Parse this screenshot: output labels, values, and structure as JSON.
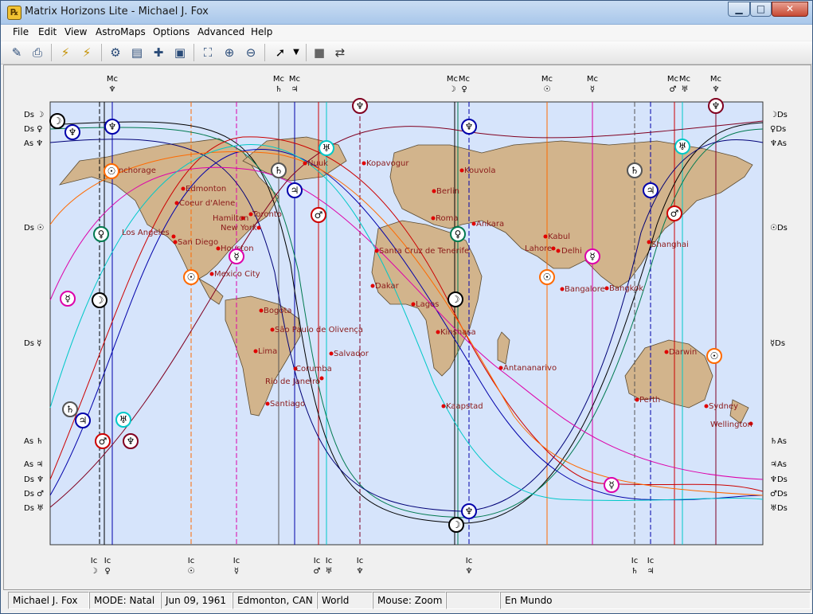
{
  "window": {
    "title": "Matrix Horizons Lite - Michael J. Fox",
    "app_icon": "app-logo-icon"
  },
  "menu": [
    "File",
    "Edit",
    "View",
    "AstroMaps",
    "Options",
    "Advanced",
    "Help"
  ],
  "toolbar_icons": [
    "edit-chart-icon",
    "print-icon",
    "planet-lines-icon",
    "planet-lines-alt-icon",
    "settings-icon",
    "chart-data-icon",
    "add-location-icon",
    "monitor-icon",
    "fit-map-icon",
    "zoom-in-icon",
    "zoom-out-icon",
    "pointer-icon",
    "pointer-dropdown-icon",
    "stop-icon",
    "swap-icon"
  ],
  "map": {
    "top_labels": [
      {
        "label": "Mc",
        "glyph": "♆"
      },
      {
        "label": "Mc",
        "glyph": "♄"
      },
      {
        "label": "Mc",
        "glyph": "♃"
      },
      {
        "label": "Mc",
        "glyph": "☽"
      },
      {
        "label": "Mc",
        "glyph": "♀"
      },
      {
        "label": "Mc",
        "glyph": "☉"
      },
      {
        "label": "Mc",
        "glyph": "☿"
      },
      {
        "label": "Mc",
        "glyph": "♂"
      },
      {
        "label": "Mc",
        "glyph": "♅"
      },
      {
        "label": "Mc",
        "glyph": "♆"
      }
    ],
    "bottom_labels": [
      {
        "label": "Ic",
        "glyph": "☽"
      },
      {
        "label": "Ic",
        "glyph": "♀"
      },
      {
        "label": "Ic",
        "glyph": "☉"
      },
      {
        "label": "Ic",
        "glyph": "☿"
      },
      {
        "label": "Ic",
        "glyph": "♂"
      },
      {
        "label": "Ic",
        "glyph": "♅"
      },
      {
        "label": "Ic",
        "glyph": "♆"
      },
      {
        "label": "Ic",
        "glyph": "♆"
      },
      {
        "label": "Ic",
        "glyph": "♄"
      },
      {
        "label": "Ic",
        "glyph": "♃"
      }
    ],
    "left_labels": [
      "Ds ☽",
      "Ds ♀",
      "As ♆",
      "Ds ☉",
      "Ds ☿",
      "As ♄",
      "As ♃",
      "Ds ♆",
      "Ds ♂",
      "Ds ♅"
    ],
    "right_labels": [
      "☽Ds",
      "♀Ds",
      "♆As",
      "☉Ds",
      "☿Ds",
      "♄As",
      "♃As",
      "♆Ds",
      "♂Ds",
      "♅Ds"
    ],
    "cities": [
      "Anchorage",
      "Edmonton",
      "Coeur d'Alene",
      "Hamilton",
      "Toronto",
      "New York",
      "Los Angeles",
      "San Diego",
      "Houston",
      "Mexico City",
      "Bogota",
      "São Paulo de Olivença",
      "Lima",
      "Salvador",
      "Corumba",
      "Rio de Janeiro",
      "Santiago",
      "Nuuk",
      "Kopavogur",
      "Kouvola",
      "Berlin",
      "Roma",
      "Ankara",
      "Santa Cruz de Tenerife",
      "Dakar",
      "Lagos",
      "Kinshasa",
      "Kaapstad",
      "Antananarivo",
      "Kabul",
      "Lahore",
      "Delhi",
      "Bangalore",
      "Bangkok",
      "Shanghai",
      "Darwin",
      "Perth",
      "Sydney",
      "Wellington"
    ],
    "colors": {
      "ocean": "#d6e4fb",
      "land": "#d2b48c",
      "city": "#8b1a1a"
    }
  },
  "status": {
    "name": "Michael J. Fox",
    "mode": "MODE: Natal",
    "date": "Jun 09, 1961",
    "place": "Edmonton, CAN",
    "region": "World",
    "mouse": "Mouse: Zoom",
    "blank": "",
    "mundo": "En Mundo"
  }
}
